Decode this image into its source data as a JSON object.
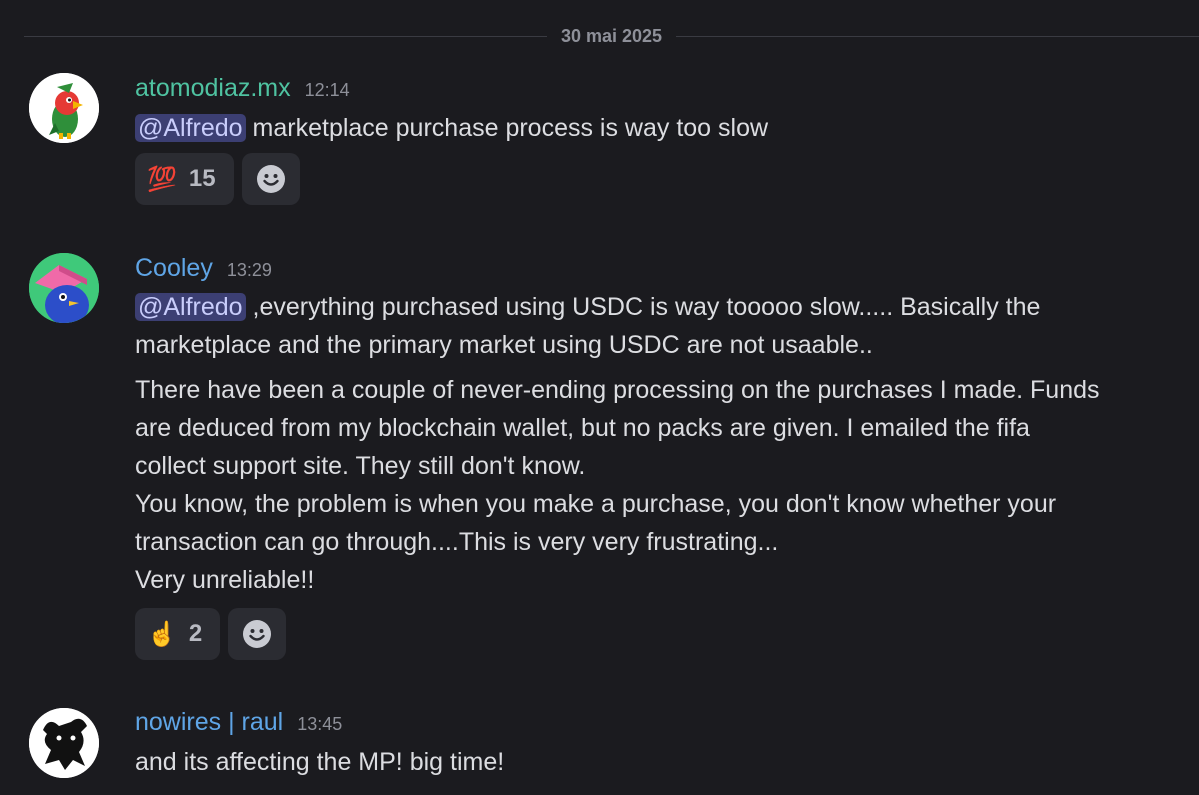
{
  "date_divider": "30 mai 2025",
  "colors": {
    "background": "#1b1b1f",
    "mention_bg": "#3c3f73",
    "mention_fg": "#c9cdfb",
    "username_green": "#4fc3a1",
    "username_blue": "#5fa5e6"
  },
  "messages": [
    {
      "author": "atomodiaz.mx",
      "time": "12:14",
      "mention": "@Alfredo",
      "text": " marketplace purchase process is way too slow",
      "reaction": {
        "emoji_icon": "hundred-points-icon",
        "glyph": "💯",
        "count": "15"
      }
    },
    {
      "author": "Cooley",
      "time": "13:29",
      "mention": "@Alfredo",
      "text_line1": " ,everything purchased using USDC is way tooooo slow..... Basically the",
      "text_line2": "marketplace and the primary market using USDC are not usaable..",
      "para2_line1": "There have been a couple of never-ending processing on the purchases I made. Funds",
      "para2_line2": "are deduced from my blockchain wallet, but no packs are given. I emailed the fifa",
      "para2_line3": "collect support site. They still don't know.",
      "para2_line4": "You know, the problem is when you make a purchase, you don't know whether your",
      "para2_line5": "transaction can go through....This is very very frustrating...",
      "para2_line6": "Very unreliable!!",
      "reaction": {
        "emoji_icon": "pointing-up-hand-icon",
        "glyph": "☝️",
        "count": "2"
      }
    },
    {
      "author": "nowires | raul",
      "time": "13:45",
      "text": "and its affecting the MP! big time!"
    }
  ]
}
